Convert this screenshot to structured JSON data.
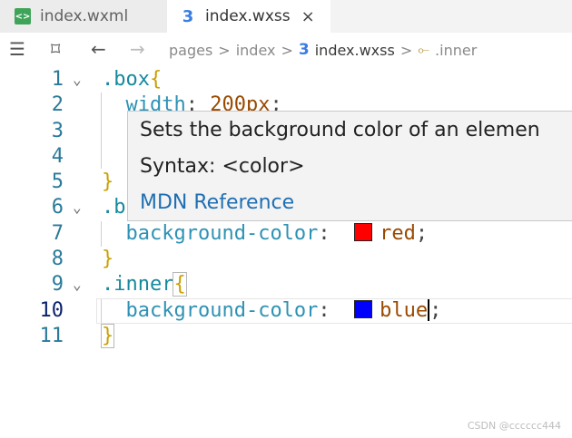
{
  "tabs": [
    {
      "label": "index.wxml",
      "icon": "wxml-file-icon"
    },
    {
      "label": "index.wxss",
      "icon": "css-file-icon",
      "close": "×"
    }
  ],
  "breadcrumb": {
    "items": [
      "pages",
      "index",
      "index.wxss",
      ".inner"
    ],
    "separator": ">"
  },
  "editor": {
    "line_numbers": [
      "1",
      "2",
      "3",
      "4",
      "5",
      "6",
      "7",
      "8",
      "9",
      "10",
      "11"
    ],
    "line1": {
      "selector": ".box",
      "brace": "{"
    },
    "line2": {
      "prop": "width",
      "colon": ":",
      "value": "200px",
      "semi": ";"
    },
    "line5": {
      "brace": "}"
    },
    "line6": {
      "selector": ".b"
    },
    "line7": {
      "prop": "background-color",
      "colon": ":",
      "value": "red",
      "semi": ";",
      "swatch": "#ff0000"
    },
    "line8": {
      "brace": "}"
    },
    "line9": {
      "selector": ".inner",
      "brace": "{"
    },
    "line10": {
      "prop": "background-color",
      "colon": ":",
      "value": "blue",
      "semi": ";",
      "swatch": "#0000ff"
    },
    "line11": {
      "brace": "}"
    }
  },
  "hover": {
    "description": "Sets the background color of an elemen",
    "syntax": "Syntax: <color>",
    "link": "MDN Reference"
  },
  "watermark": "CSDN @cccccc444"
}
